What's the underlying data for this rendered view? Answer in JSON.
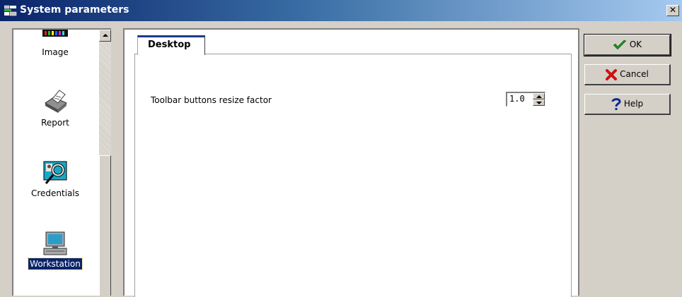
{
  "window": {
    "title": "System parameters",
    "close_label": "✕"
  },
  "sidebar": {
    "items": [
      {
        "label": "Image",
        "icon": "image-icon",
        "selected": false
      },
      {
        "label": "Report",
        "icon": "printer-icon",
        "selected": false
      },
      {
        "label": "Credentials",
        "icon": "credentials-icon",
        "selected": false
      },
      {
        "label": "Workstation",
        "icon": "workstation-icon",
        "selected": true
      }
    ]
  },
  "tabs": [
    {
      "label": "Desktop",
      "active": true
    }
  ],
  "settings": [
    {
      "label": "Toolbar buttons resize factor",
      "value": "1.0"
    }
  ],
  "buttons": {
    "ok": {
      "label": "OK",
      "icon": "checkmark-icon",
      "color": "#1e8a1e"
    },
    "cancel": {
      "label": "Cancel",
      "icon": "red-x-icon",
      "color": "#cc1111"
    },
    "help": {
      "label": "Help",
      "icon": "question-mark-icon",
      "color": "#0a2a8a"
    }
  },
  "colors": {
    "titlebar_start": "#0a246a",
    "titlebar_end": "#a6caf0",
    "selection": "#0a246a",
    "face": "#d4d0c8"
  }
}
